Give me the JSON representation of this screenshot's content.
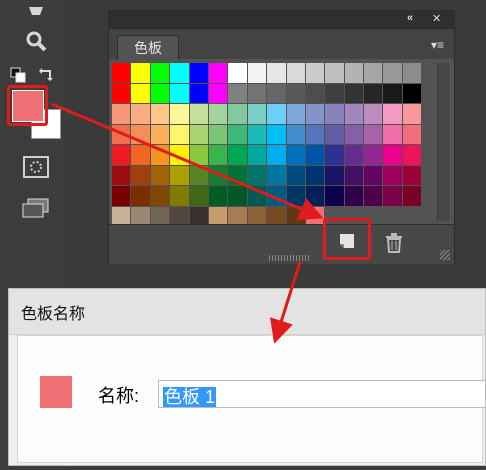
{
  "tools": [
    {
      "name": "hand-icon"
    },
    {
      "name": "zoom-icon"
    },
    {
      "name": "default-colors-icon"
    },
    {
      "name": "swap-colors-icon"
    },
    {
      "name": "quick-mask-icon"
    },
    {
      "name": "screen-mode-icon"
    }
  ],
  "foreground_color": "#f07075",
  "background_color": "#ffffff",
  "panel": {
    "tab_label": "色板",
    "collapse_icon": "«",
    "close_icon": "✕",
    "menu_icon": "▾≡"
  },
  "swatches": [
    "#ff0000",
    "#ffff00",
    "#00ff00",
    "#00ffff",
    "#0000ff",
    "#ff00ff",
    "#ffffff",
    "#f2f2f2",
    "#e6e6e6",
    "#d9d9d9",
    "#cccccc",
    "#bfbfbf",
    "#b3b3b3",
    "#a6a6a6",
    "#999999",
    "#8c8c8c",
    "#ff0000",
    "#ffff00",
    "#00ff00",
    "#00ffff",
    "#0000ff",
    "#ff00ff",
    "#808080",
    "#737373",
    "#666666",
    "#595959",
    "#4d4d4d",
    "#404040",
    "#333333",
    "#262626",
    "#1a1a1a",
    "#000000",
    "#f7977a",
    "#f9ad81",
    "#fdc68a",
    "#fff79a",
    "#c4df9b",
    "#a3d39c",
    "#82ca9d",
    "#7bcdc8",
    "#6ecff6",
    "#7ea7d8",
    "#8493ca",
    "#8882be",
    "#a187be",
    "#bc8dbf",
    "#f49ac2",
    "#f6989d",
    "#f26c4f",
    "#f68e56",
    "#fbaf5d",
    "#fff568",
    "#acd373",
    "#7cc576",
    "#3cb878",
    "#1cbbb4",
    "#00bff3",
    "#438ccb",
    "#5674b9",
    "#605ca8",
    "#855fa8",
    "#a763a8",
    "#f06ea9",
    "#f26d7d",
    "#ed1c24",
    "#f26522",
    "#f7941d",
    "#fff200",
    "#8dc73f",
    "#39b54a",
    "#00a651",
    "#00a99d",
    "#00aeef",
    "#0072bc",
    "#0054a6",
    "#2e3192",
    "#662d91",
    "#92278f",
    "#ec008c",
    "#ed145b",
    "#9e0b0f",
    "#a0410d",
    "#a36209",
    "#aba000",
    "#598527",
    "#197b30",
    "#007236",
    "#00746b",
    "#0076a3",
    "#004b80",
    "#003471",
    "#1b1464",
    "#440e62",
    "#630460",
    "#9e005d",
    "#9e0039",
    "#790000",
    "#7b2e00",
    "#7d4900",
    "#827b00",
    "#406618",
    "#005e20",
    "#005826",
    "#005952",
    "#005b7f",
    "#003663",
    "#002157",
    "#0d004c",
    "#32004b",
    "#4b0049",
    "#7b0046",
    "#7a0026",
    "#c7b299",
    "#998675",
    "#736357",
    "#534741",
    "#37302d",
    "#c69c6d",
    "#a67c52",
    "#8c6239",
    "#754c24",
    "#603913",
    "#f07075"
  ],
  "dialog": {
    "title": "色板名称",
    "name_label": "名称:",
    "name_value": "色板 1"
  },
  "colors": {
    "highlight": "#e01b1b",
    "panel_bg": "#535353",
    "selection": "#3399ff"
  }
}
